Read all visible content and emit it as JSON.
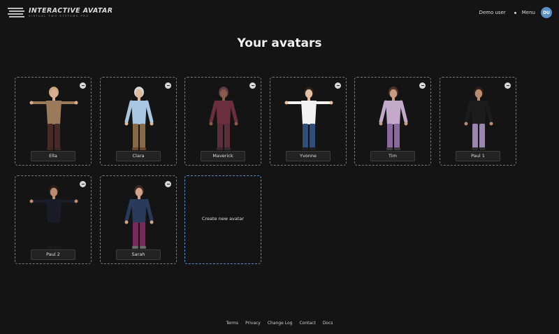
{
  "header": {
    "logo_title": "INTERACTIVE AVATAR",
    "logo_subtitle": "VIRTUAL TWO SYSTEMS PRO",
    "user_name": "Demo user",
    "menu_label": "Menu",
    "user_initials": "DU"
  },
  "page": {
    "title": "Your avatars"
  },
  "avatars": [
    {
      "name": "Ella",
      "figure": {
        "hair": "#c9a77d",
        "skin": "#d9ad92",
        "top": "#9a7a5a",
        "legs": "#4a2a28",
        "shoes": "#3a2a22",
        "arms": "t"
      }
    },
    {
      "name": "Clara",
      "figure": {
        "hair": "#cfd6dc",
        "skin": "#e0b89a",
        "top": "#a9c7e0",
        "legs": "#8a6a44",
        "shoes": "#6a4a2a",
        "arms": "down"
      }
    },
    {
      "name": "Maverick",
      "figure": {
        "hair": "#5a3a4a",
        "skin": "#8a5a4a",
        "top": "#6a2e3e",
        "legs": "#5a2e3a",
        "shoes": "#3a2a2a",
        "arms": "down"
      }
    },
    {
      "name": "Yvonne",
      "figure": {
        "hair": "#2a1e1a",
        "skin": "#e3c0a5",
        "top": "#f2f2f2",
        "legs": "#2f4f7a",
        "shoes": "#1e1e1e",
        "arms": "t"
      }
    },
    {
      "name": "Tim",
      "figure": {
        "hair": "#4a3428",
        "skin": "#c89a80",
        "top": "#c2a9c9",
        "legs": "#8a6a9e",
        "shoes": "#3a3a3a",
        "arms": "down"
      }
    },
    {
      "name": "Paul 1",
      "figure": {
        "hair": "#2a1e18",
        "skin": "#b98c70",
        "top": "#1c1c1c",
        "legs": "#9a86ae",
        "shoes": "#2a2a2a",
        "arms": "down"
      }
    },
    {
      "name": "Paul 2",
      "figure": {
        "hair": "#2a1e18",
        "skin": "#b98c70",
        "top": "#1a1d28",
        "legs": "#151515",
        "shoes": "#1a1a1a",
        "arms": "t"
      }
    },
    {
      "name": "Sarah",
      "figure": {
        "hair": "#3a2a22",
        "skin": "#d0a48a",
        "top": "#2a3a5a",
        "legs": "#7a2a5a",
        "shoes": "#6a6a6a",
        "arms": "down"
      }
    }
  ],
  "create": {
    "label": "Create new avatar"
  },
  "footer": {
    "links": [
      "Terms",
      "Privacy",
      "Change Log",
      "Contact",
      "Docs"
    ]
  }
}
